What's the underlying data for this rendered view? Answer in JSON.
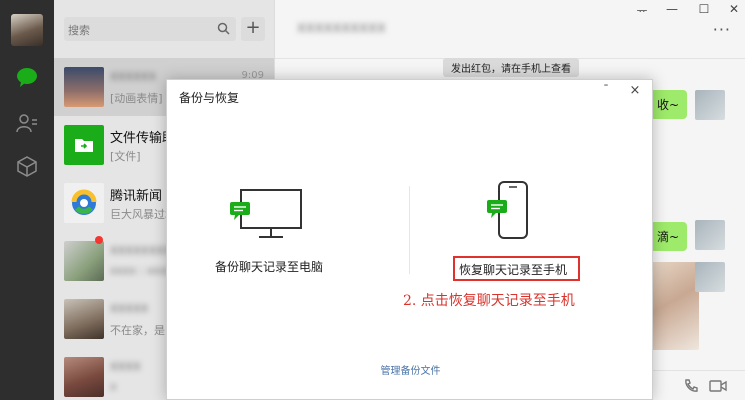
{
  "sidebar": {
    "icons": [
      "avatar",
      "chat-icon",
      "contacts-icon",
      "cube-icon"
    ],
    "accent": "#1aad19"
  },
  "session_list": {
    "search_placeholder": "搜索",
    "add_label": "+",
    "sessions": [
      {
        "name": "",
        "preview": "[动画表情]",
        "time": "9:09",
        "blurred_name": true
      },
      {
        "name": "文件传输助",
        "preview": "[文件]",
        "time": ""
      },
      {
        "name": "腾讯新闻",
        "preview": "巨大风暴过境",
        "time": ""
      },
      {
        "name": "",
        "preview": "",
        "time": "",
        "blurred_name": true,
        "unread_dot": true
      },
      {
        "name": "",
        "preview": "不在家，是",
        "time": "",
        "blurred_name": true
      },
      {
        "name": "",
        "preview": "",
        "time": "",
        "blurred_name": true
      }
    ]
  },
  "chat": {
    "title": "",
    "window_controls": [
      "ᅲ",
      "—",
      "☐",
      "✕"
    ],
    "more": "···",
    "system_note": "发出红包，请在手机上查看",
    "bubbles": [
      "收~",
      "滴~"
    ],
    "bubble_color": "#9eea6a"
  },
  "modal": {
    "title": "备份与恢复",
    "minimize": "ˉ",
    "close": "×",
    "backup_label": "备份聊天记录至电脑",
    "restore_label": "恢复聊天记录至手机",
    "annotation": "2. 点击恢复聊天记录至手机",
    "manage_link": "管理备份文件",
    "highlight_color": "#e0312d"
  }
}
